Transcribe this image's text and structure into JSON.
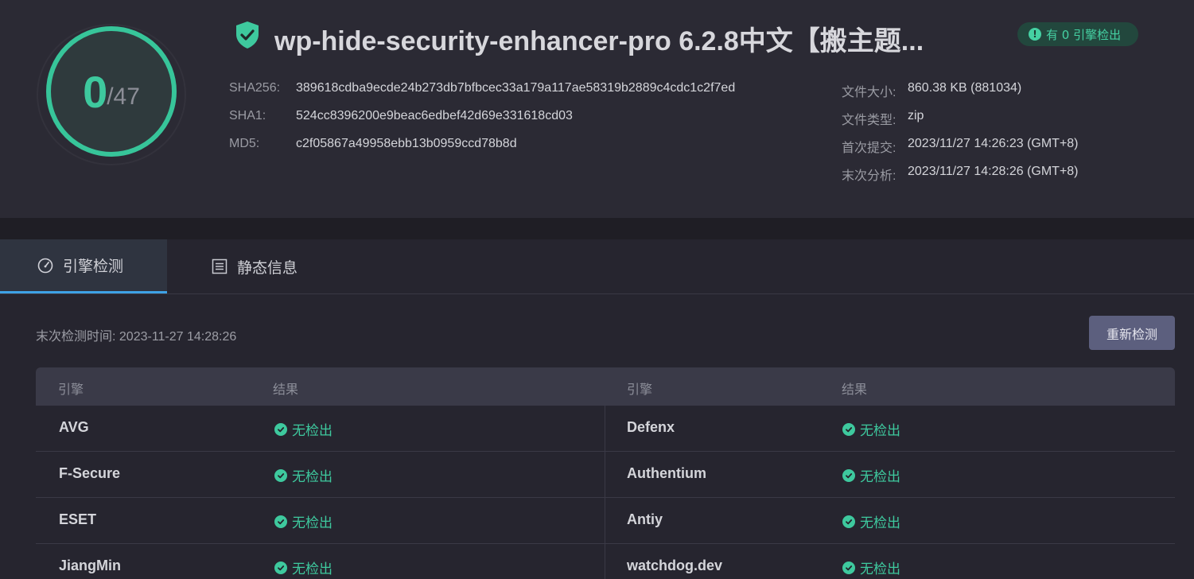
{
  "score": {
    "detected": "0",
    "total": "/47"
  },
  "file": {
    "title": "wp-hide-security-enhancer-pro 6.2.8中文【搬主题...",
    "badge": "有 0 引擎检出"
  },
  "hashes": [
    {
      "label": "SHA256:",
      "value": "389618cdba9ecde24b273db7bfbcec33a179a117ae58319b2889c4cdc1c2f7ed"
    },
    {
      "label": "SHA1:",
      "value": "524cc8396200e9beac6edbef42d69e331618cd03"
    },
    {
      "label": "MD5:",
      "value": "c2f05867a49958ebb13b0959ccd78b8d"
    }
  ],
  "info": [
    {
      "label": "文件大小:",
      "value": "860.38 KB (881034)"
    },
    {
      "label": "文件类型:",
      "value": "zip"
    },
    {
      "label": "首次提交:",
      "value": "2023/11/27 14:26:23 (GMT+8)"
    },
    {
      "label": "末次分析:",
      "value": "2023/11/27 14:28:26 (GMT+8)"
    }
  ],
  "tabs": [
    {
      "label": "引擎检测",
      "icon": "gauge-icon"
    },
    {
      "label": "静态信息",
      "icon": "list-icon"
    }
  ],
  "last_detect": "末次检测时间: 2023-11-27 14:28:26",
  "redetect_label": "重新检测",
  "table": {
    "headers": [
      "引擎",
      "结果",
      "引擎",
      "结果"
    ],
    "rows": [
      {
        "e1": "AVG",
        "r1": "无检出",
        "e2": "Defenx",
        "r2": "无检出"
      },
      {
        "e1": "F-Secure",
        "r1": "无检出",
        "e2": "Authentium",
        "r2": "无检出"
      },
      {
        "e1": "ESET",
        "r1": "无检出",
        "e2": "Antiy",
        "r2": "无检出"
      },
      {
        "e1": "JiangMin",
        "r1": "无检出",
        "e2": "watchdog.dev",
        "r2": "无检出"
      }
    ]
  },
  "colors": {
    "accent": "#3ec99e",
    "tab_active": "#3ea2e6",
    "button": "#5c5f7e"
  }
}
